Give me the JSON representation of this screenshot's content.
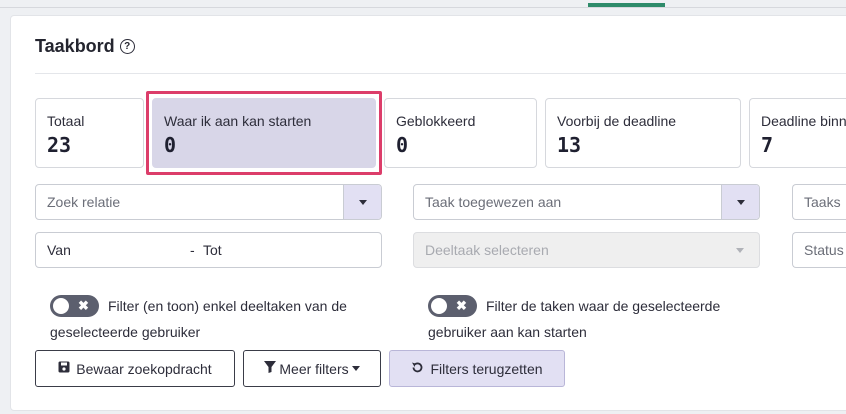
{
  "page": {
    "title": "Taakbord",
    "help_icon": "?"
  },
  "stats": [
    {
      "label": "Totaal",
      "value": "23"
    },
    {
      "label": "Waar ik aan kan starten",
      "value": "0",
      "selected": true
    },
    {
      "label": "Geblokkeerd",
      "value": "0"
    },
    {
      "label": "Voorbij de deadline",
      "value": "13"
    },
    {
      "label": "Deadline binn",
      "value": "7"
    }
  ],
  "filters": {
    "relation_placeholder": "Zoek relatie",
    "assignee_placeholder": "Taak toegewezen aan",
    "task_type_placeholder": "Taaks",
    "date_from": "Van",
    "date_separator": "-",
    "date_to": "Tot",
    "subtask_placeholder": "Deeltaak selecteren",
    "status_placeholder": "Status"
  },
  "toggles": {
    "subtasks_label": "Filter (en toon) enkel deeltaken van de geselecteerde gebruiker",
    "startable_label": "Filter de taken waar de geselecteerde gebruiker aan kan starten"
  },
  "buttons": {
    "save_search": "Bewaar zoekopdracht",
    "more_filters": "Meer filters",
    "reset_filters": "Filters terugzetten"
  },
  "colors": {
    "accent": "#dc3d6a",
    "selected_bg": "#d8d6e8",
    "toggle_off": "#5c5f6e",
    "tab_accent": "#2e8b6a"
  }
}
